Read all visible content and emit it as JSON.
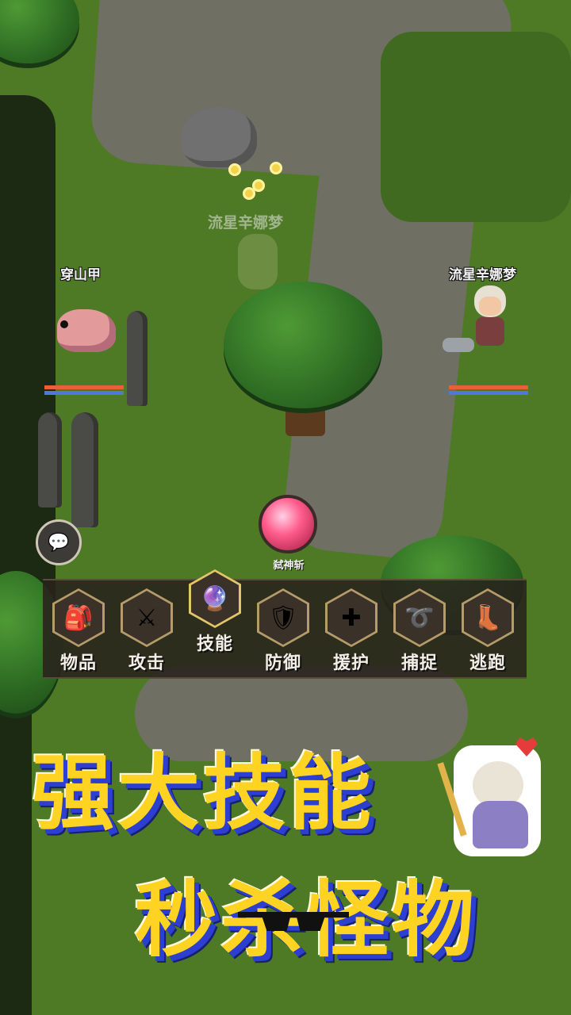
{
  "battle": {
    "enemy_name": "穿山甲",
    "player_name": "流星辛娜梦",
    "player_ghost_name": "流星辛娜梦",
    "enemy_hp": 1.0,
    "player_hp": 1.0
  },
  "skill": {
    "name": "弑神斩"
  },
  "actions": [
    {
      "label": "物品",
      "icon": "bag-icon",
      "glyph": "🎒"
    },
    {
      "label": "攻击",
      "icon": "sword-icon",
      "glyph": "⚔"
    },
    {
      "label": "技能",
      "icon": "magic-orb-icon",
      "glyph": "🔮"
    },
    {
      "label": "防御",
      "icon": "shield-icon",
      "glyph": "🛡"
    },
    {
      "label": "援护",
      "icon": "support-icon",
      "glyph": "✚"
    },
    {
      "label": "捕捉",
      "icon": "rope-icon",
      "glyph": "➰"
    },
    {
      "label": "逃跑",
      "icon": "boot-icon",
      "glyph": "👢"
    }
  ],
  "selected_action": "技能",
  "chat": {
    "icon": "chat-bubble-icon",
    "glyph": "💬"
  },
  "promo": {
    "line1": "强大技能",
    "line2": "秒杀怪物"
  },
  "colors": {
    "banner_yellow": "#ffd321",
    "banner_blue": "#2c3fd0",
    "hp_red": "#e8603a",
    "hp_blue": "#4f78d8"
  }
}
